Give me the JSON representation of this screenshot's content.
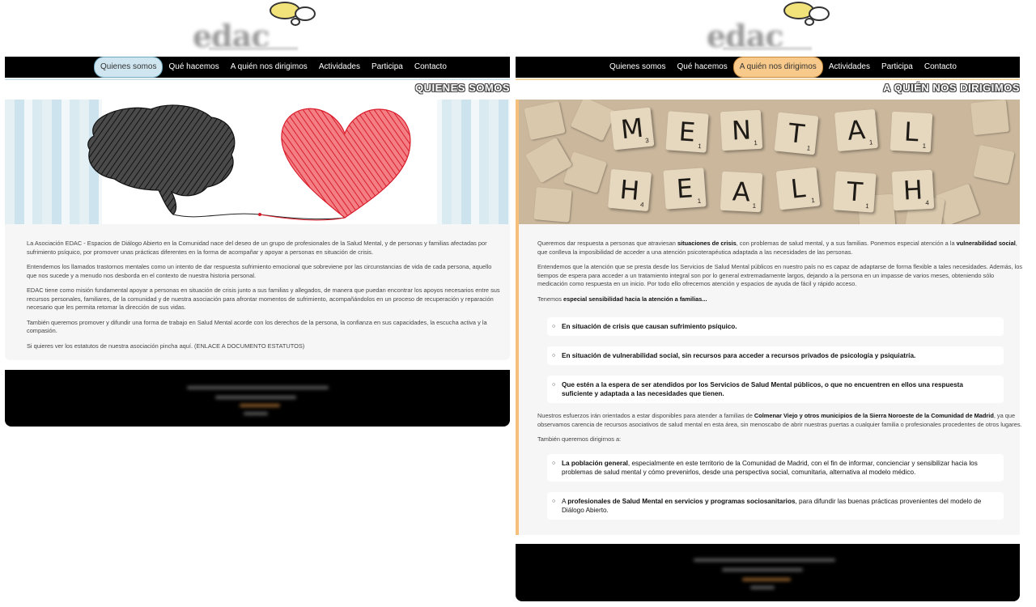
{
  "brand": {
    "logo_text": "edac"
  },
  "nav": {
    "items": [
      "Quienes somos",
      "Qué hacemos",
      "A quién nos dirigimos",
      "Actividades",
      "Participa",
      "Contacto"
    ]
  },
  "left": {
    "active_index": 0,
    "section_title": "QUIENES SOMOS",
    "accent_color": "#cfe6f0",
    "paragraphs": [
      "La Asociación EDAC - Espacios de Diálogo Abierto en la Comunidad nace del deseo de un grupo de profesionales de la Salud Mental, y de personas y familias afectadas por sufrimiento psíquico, por promover unas prácticas diferentes en la forma de acompañar y apoyar a personas en situación de crisis.",
      "Entendemos los llamados trastornos mentales como un intento de dar respuesta sufrimiento emocional que sobreviene por las circunstancias de vida de cada persona, aquello que nos sucede y a menudo nos desborda en el contexto de nuestra historia personal.",
      "EDAC tiene como misión fundamental apoyar a personas en situación de crisis junto a sus familias y allegados, de manera que puedan encontrar los apoyos necesarios entre sus recursos personales, familiares, de la comunidad y de nuestra asociación para afrontar momentos de sufrimiento, acompañándolos en un proceso de recuperación y reparación necesario que les permita retomar la dirección de sus vidas.",
      "También queremos promover y difundir una forma de trabajo en Salud Mental acorde con los derechos de la persona, la confianza en sus capacidades, la escucha activa y la compasión.",
      "Si quieres ver los estatutos de nuestra asociación pincha aquí. (ENLACE A DOCUMENTO ESTATUTOS)"
    ]
  },
  "right": {
    "active_index": 2,
    "section_title": "A QUIÉN NOS DIRIGIMOS",
    "accent_color": "#f7c98a",
    "banner_words": [
      "MENTAL",
      "HEALTH"
    ],
    "p1": {
      "a": "Queremos dar respuesta a personas que atraviesan ",
      "b": "situaciones de crisis",
      "c": ", con problemas de salud mental, y a sus familias. Ponemos especial atención a la ",
      "d": "vulnerabilidad social",
      "e": ", que conlleva la imposibilidad de acceder a una atención psicoterapéutica adaptada a las necesidades de las personas."
    },
    "p2": "Entendemos que la atención que se presta desde los Servicios de Salud Mental públicos en nuestro país no es capaz de adaptarse de forma flexible a tales necesidades. Además, los tiempos de espera para acceder a un tratamiento integral son por lo general extremadamente largos, dejando a la persona en un impasse de varios meses, obteniendo sólo medicación como respuesta en un inicio. Por todo ello ofrecemos atención y espacios de ayuda de fácil y rápido acceso.",
    "p3": {
      "a": "Tenemos ",
      "b": "especial sensibilidad hacia la atención a familias..."
    },
    "bullets1": [
      "En situación de crisis que causan sufrimiento psíquico.",
      "En situación de vulnerabilidad social, sin recursos para acceder a recursos privados de psicología y psiquiatría.",
      "Que estén a la espera de ser atendidos por los Servicios de Salud Mental públicos, o que no encuentren en ellos una respuesta suficiente y adaptada a las necesidades que tienen."
    ],
    "p4": {
      "a": "Nuestros esfuerzos irán orientados a estar disponibles para atender a familias de ",
      "b": "Colmenar Viejo y otros municipios de la Sierra Noroeste de la Comunidad de Madrid",
      "c": ", ya que observamos carencia de recursos asociativos de salud mental en esta área, sin menoscabo de abrir nuestras puertas a cualquier familia o profesionales procedentes de otros lugares."
    },
    "p5": "También queremos dirigirnos a:",
    "bullet_a": {
      "b": "La población general",
      "c": ", especialmente en este territorio de la Comunidad de Madrid, con el fin de informar, concienciar y sensibilizar hacia los problemas de salud mental y cómo prevenirlos, desde una perspectiva social, comunitaria, alternativa al modelo médico."
    },
    "bullet_b": {
      "a": "A ",
      "b": "profesionales de Salud Mental en servicios y programas sociosanitarios",
      "c": ", para difundir las buenas prácticas provenientes del modelo de Diálogo Abierto."
    }
  }
}
